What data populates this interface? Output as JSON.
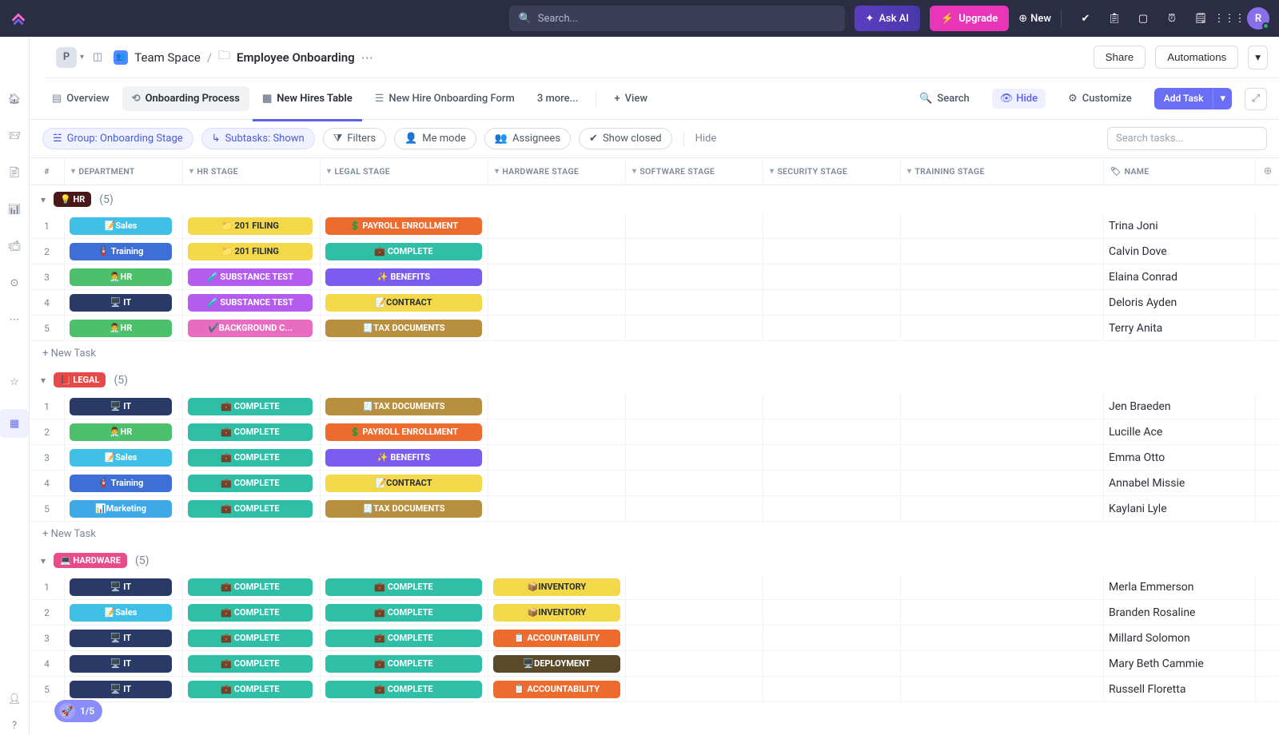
{
  "top": {
    "search_placeholder": "Search...",
    "ask_ai": "Ask AI",
    "upgrade": "Upgrade",
    "new": "New",
    "avatar": "R"
  },
  "workspace": {
    "badge": "P",
    "breadcrumb_team": "Team Space",
    "breadcrumb_current": "Employee Onboarding",
    "share": "Share",
    "automations": "Automations"
  },
  "tabs": {
    "overview": "Overview",
    "process": "Onboarding Process",
    "hires": "New Hires Table",
    "form": "New Hire Onboarding Form",
    "more": "3 more...",
    "view": "View",
    "search": "Search",
    "hide": "Hide",
    "customize": "Customize",
    "add_task": "Add Task"
  },
  "filters": {
    "group": "Group: Onboarding Stage",
    "subtasks": "Subtasks: Shown",
    "filters": "Filters",
    "me_mode": "Me mode",
    "assignees": "Assignees",
    "show_closed": "Show closed",
    "hide": "Hide",
    "search_placeholder": "Search tasks..."
  },
  "columns": {
    "idx": "#",
    "dept": "DEPARTMENT",
    "hr": "HR STAGE",
    "legal": "LEGAL STAGE",
    "hardware": "HARDWARE STAGE",
    "software": "SOFTWARE STAGE",
    "security": "SECURITY STAGE",
    "training": "TRAINING STAGE",
    "name": "NAME"
  },
  "groups": [
    {
      "label": "HR",
      "emoji": "💡",
      "color": "c-red",
      "count": "(5)",
      "rows": [
        {
          "i": "1",
          "dept": {
            "t": "📝Sales",
            "c": "c-sky"
          },
          "hr": {
            "t": "📁 201 FILING",
            "c": "c-yellow"
          },
          "legal": {
            "t": "💲 PAYROLL ENROLLMENT",
            "c": "c-orangeD"
          },
          "name": "Trina Joni"
        },
        {
          "i": "2",
          "dept": {
            "t": "🧯 Training",
            "c": "c-blue"
          },
          "hr": {
            "t": "📁 201 FILING",
            "c": "c-yellow"
          },
          "legal": {
            "t": "💼 COMPLETE",
            "c": "c-teal"
          },
          "name": "Calvin Dove"
        },
        {
          "i": "3",
          "dept": {
            "t": "👨‍💼HR",
            "c": "c-green"
          },
          "hr": {
            "t": "🧪 SUBSTANCE TEST",
            "c": "c-purple"
          },
          "legal": {
            "t": "✨ BENEFITS",
            "c": "c-violet"
          },
          "name": "Elaina Conrad"
        },
        {
          "i": "4",
          "dept": {
            "t": "🖥️ IT",
            "c": "c-navy"
          },
          "hr": {
            "t": "🧪 SUBSTANCE TEST",
            "c": "c-purple"
          },
          "legal": {
            "t": "📝CONTRACT",
            "c": "c-yellow"
          },
          "name": "Deloris Ayden"
        },
        {
          "i": "5",
          "dept": {
            "t": "👨‍💼HR",
            "c": "c-green"
          },
          "hr": {
            "t": "✔️BACKGROUND C...",
            "c": "c-pink"
          },
          "legal": {
            "t": "🧾TAX DOCUMENTS",
            "c": "c-brown"
          },
          "name": "Terry Anita"
        }
      ]
    },
    {
      "label": "LEGAL",
      "emoji": "📕",
      "color": "c-legalred",
      "count": "(5)",
      "rows": [
        {
          "i": "1",
          "dept": {
            "t": "🖥️ IT",
            "c": "c-navy"
          },
          "hr": {
            "t": "💼 COMPLETE",
            "c": "c-teal"
          },
          "legal": {
            "t": "🧾TAX DOCUMENTS",
            "c": "c-brown"
          },
          "name": "Jen Braeden"
        },
        {
          "i": "2",
          "dept": {
            "t": "👨‍💼HR",
            "c": "c-green"
          },
          "hr": {
            "t": "💼 COMPLETE",
            "c": "c-teal"
          },
          "legal": {
            "t": "💲 PAYROLL ENROLLMENT",
            "c": "c-orangeD"
          },
          "name": "Lucille Ace"
        },
        {
          "i": "3",
          "dept": {
            "t": "📝Sales",
            "c": "c-sky"
          },
          "hr": {
            "t": "💼 COMPLETE",
            "c": "c-teal"
          },
          "legal": {
            "t": "✨ BENEFITS",
            "c": "c-violet"
          },
          "name": "Emma Otto"
        },
        {
          "i": "4",
          "dept": {
            "t": "🧯 Training",
            "c": "c-blue"
          },
          "hr": {
            "t": "💼 COMPLETE",
            "c": "c-teal"
          },
          "legal": {
            "t": "📝CONTRACT",
            "c": "c-yellow"
          },
          "name": "Annabel Missie"
        },
        {
          "i": "5",
          "dept": {
            "t": "📊Marketing",
            "c": "c-skyblue"
          },
          "hr": {
            "t": "💼 COMPLETE",
            "c": "c-teal"
          },
          "legal": {
            "t": "🧾TAX DOCUMENTS",
            "c": "c-brown"
          },
          "name": "Kaylani Lyle"
        }
      ]
    },
    {
      "label": "HARDWARE",
      "emoji": "💻",
      "color": "c-hwpink",
      "count": "(5)",
      "rows": [
        {
          "i": "1",
          "dept": {
            "t": "🖥️ IT",
            "c": "c-navy"
          },
          "hr": {
            "t": "💼 COMPLETE",
            "c": "c-teal"
          },
          "legal": {
            "t": "💼 COMPLETE",
            "c": "c-teal"
          },
          "hw": {
            "t": "📦INVENTORY",
            "c": "c-yellow"
          },
          "name": "Merla Emmerson"
        },
        {
          "i": "2",
          "dept": {
            "t": "📝Sales",
            "c": "c-sky"
          },
          "hr": {
            "t": "💼 COMPLETE",
            "c": "c-teal"
          },
          "legal": {
            "t": "💼 COMPLETE",
            "c": "c-teal"
          },
          "hw": {
            "t": "📦INVENTORY",
            "c": "c-yellow"
          },
          "name": "Branden Rosaline"
        },
        {
          "i": "3",
          "dept": {
            "t": "🖥️ IT",
            "c": "c-navy"
          },
          "hr": {
            "t": "💼 COMPLETE",
            "c": "c-teal"
          },
          "legal": {
            "t": "💼 COMPLETE",
            "c": "c-teal"
          },
          "hw": {
            "t": "📋 ACCOUNTABILITY",
            "c": "c-orangeD"
          },
          "name": "Millard Solomon"
        },
        {
          "i": "4",
          "dept": {
            "t": "🖥️ IT",
            "c": "c-navy"
          },
          "hr": {
            "t": "💼 COMPLETE",
            "c": "c-teal"
          },
          "legal": {
            "t": "💼 COMPLETE",
            "c": "c-teal"
          },
          "hw": {
            "t": "🖥️DEPLOYMENT",
            "c": "c-darkb"
          },
          "name": "Mary Beth Cammie"
        },
        {
          "i": "5",
          "dept": {
            "t": "🖥️ IT",
            "c": "c-navy"
          },
          "hr": {
            "t": "💼 COMPLETE",
            "c": "c-teal"
          },
          "legal": {
            "t": "💼 COMPLETE",
            "c": "c-teal"
          },
          "hw": {
            "t": "📋 ACCOUNTABILITY",
            "c": "c-orangeD"
          },
          "name": "Russell Floretta"
        }
      ]
    }
  ],
  "new_task": "+ New Task",
  "progress": "1/5"
}
